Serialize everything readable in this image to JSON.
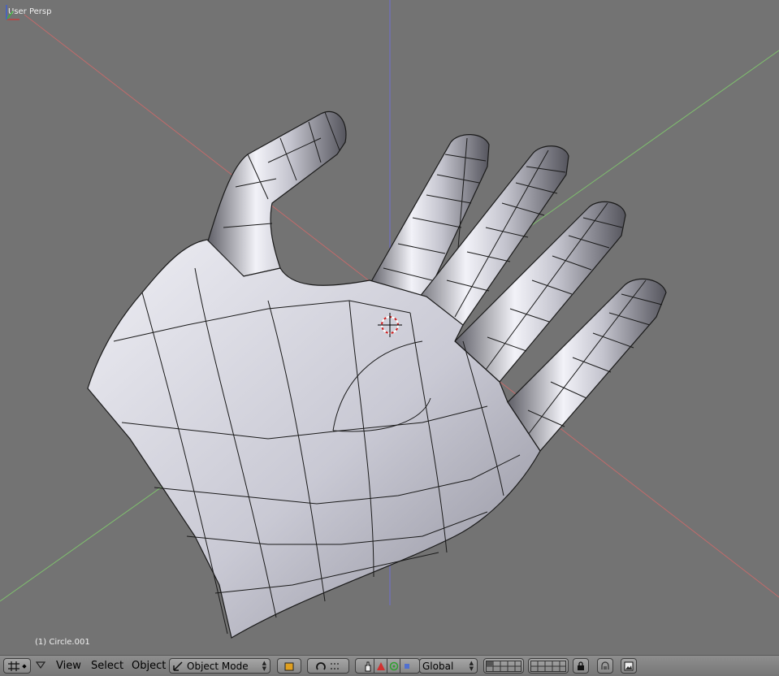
{
  "viewport": {
    "view_label": "User Persp",
    "object_label": "(1) Circle.001"
  },
  "header": {
    "menu_view": "View",
    "menu_select": "Select",
    "menu_object": "Object",
    "mode_select": "Object Mode",
    "orientation_select": "Global"
  },
  "icons": [
    "editor-type-icon",
    "menu-toggle-icon",
    "object-mode-icon",
    "viewport-shading-icon",
    "pivot-point-icon",
    "manipulator-hand-icon",
    "translate-icon",
    "rotate-icon",
    "scale-icon",
    "layers-icon",
    "lock-icon",
    "snap-icon",
    "render-icon"
  ],
  "colors": {
    "viewport_bg": "#737373",
    "x_axis": "#c26b6b",
    "y_axis": "#7fc06e",
    "z_axis": "#6f6fd0",
    "mesh_fill": "#d0d0da"
  }
}
